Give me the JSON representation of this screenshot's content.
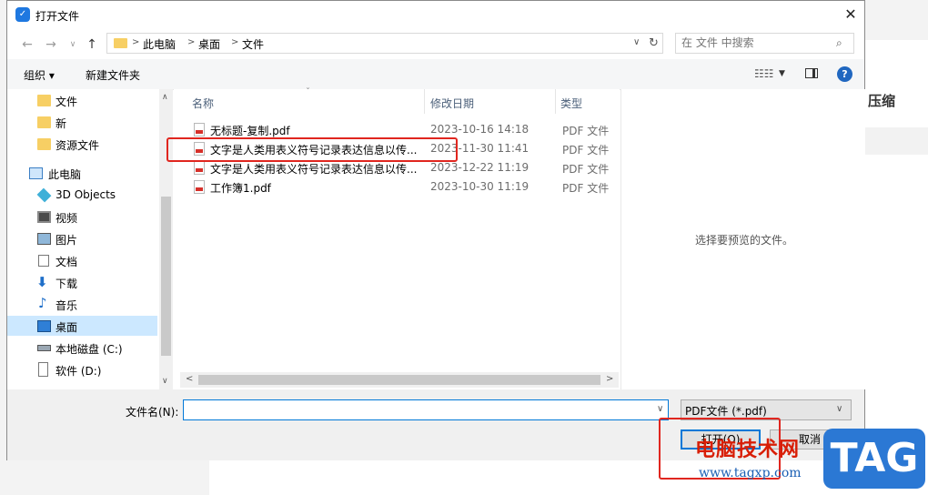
{
  "dialog": {
    "title": "打开文件",
    "close": "✕"
  },
  "nav": {
    "back": "←",
    "forward": "→",
    "up_history": "∨",
    "up": "↑",
    "breadcrumb": [
      "此电脑",
      "桌面",
      "文件"
    ],
    "crumb_sep": ">",
    "address_dropdown": "∨",
    "refresh": "↻",
    "search_placeholder": "在 文件 中搜索",
    "search_icon": "⌕"
  },
  "toolbar": {
    "organize": "组织 ▾",
    "new_folder": "新建文件夹",
    "view_icon": "☷☷",
    "view_dropdown": "▼",
    "help": "?"
  },
  "sidebar": {
    "items": [
      {
        "label": "文件",
        "icon": "folder-icon"
      },
      {
        "label": "新",
        "icon": "folder-icon"
      },
      {
        "label": "资源文件",
        "icon": "folder-icon"
      },
      {
        "label": "此电脑",
        "icon": "computer-icon"
      },
      {
        "label": "3D Objects",
        "icon": "cube-icon"
      },
      {
        "label": "视频",
        "icon": "film-icon"
      },
      {
        "label": "图片",
        "icon": "picture-icon"
      },
      {
        "label": "文档",
        "icon": "document-icon"
      },
      {
        "label": "下载",
        "icon": "download-icon"
      },
      {
        "label": "音乐",
        "icon": "music-icon"
      },
      {
        "label": "桌面",
        "icon": "desktop-icon",
        "selected": true
      },
      {
        "label": "本地磁盘 (C:)",
        "icon": "drive-icon"
      },
      {
        "label": "软件 (D:)",
        "icon": "drive-icon"
      }
    ],
    "scroll_up": "∧",
    "scroll_down": "∨"
  },
  "filelist": {
    "columns": [
      "名称",
      "修改日期",
      "类型"
    ],
    "sort_indicator": "ˇ",
    "rows": [
      {
        "name": "无标题-复制.pdf",
        "date": "2023-10-16 14:18",
        "type": "PDF 文件"
      },
      {
        "name": "文字是人类用表义符号记录表达信息以传...",
        "date": "2023-11-30 11:41",
        "type": "PDF 文件"
      },
      {
        "name": "文字是人类用表义符号记录表达信息以传...",
        "date": "2023-12-22 11:19",
        "type": "PDF 文件"
      },
      {
        "name": "工作簿1.pdf",
        "date": "2023-10-30 11:19",
        "type": "PDF 文件"
      }
    ],
    "scroll_left": "<",
    "scroll_right": ">"
  },
  "preview": {
    "text": "选择要预览的文件。"
  },
  "bottom": {
    "filename_label": "文件名(N):",
    "filename_value": "",
    "filename_dropdown": "∨",
    "filetype": "PDF文件 (*.pdf)",
    "filetype_dropdown": "∨",
    "open": "打开(O)",
    "cancel": "取消"
  },
  "background": {
    "text": "压缩"
  },
  "watermark": {
    "text": "电脑技术网",
    "url": "www.tagxp.com",
    "tag": "TAG"
  },
  "colors": {
    "accent": "#0078d7",
    "highlight": "#e0261f",
    "selected": "#cce8ff",
    "folder": "#f7cf64"
  }
}
